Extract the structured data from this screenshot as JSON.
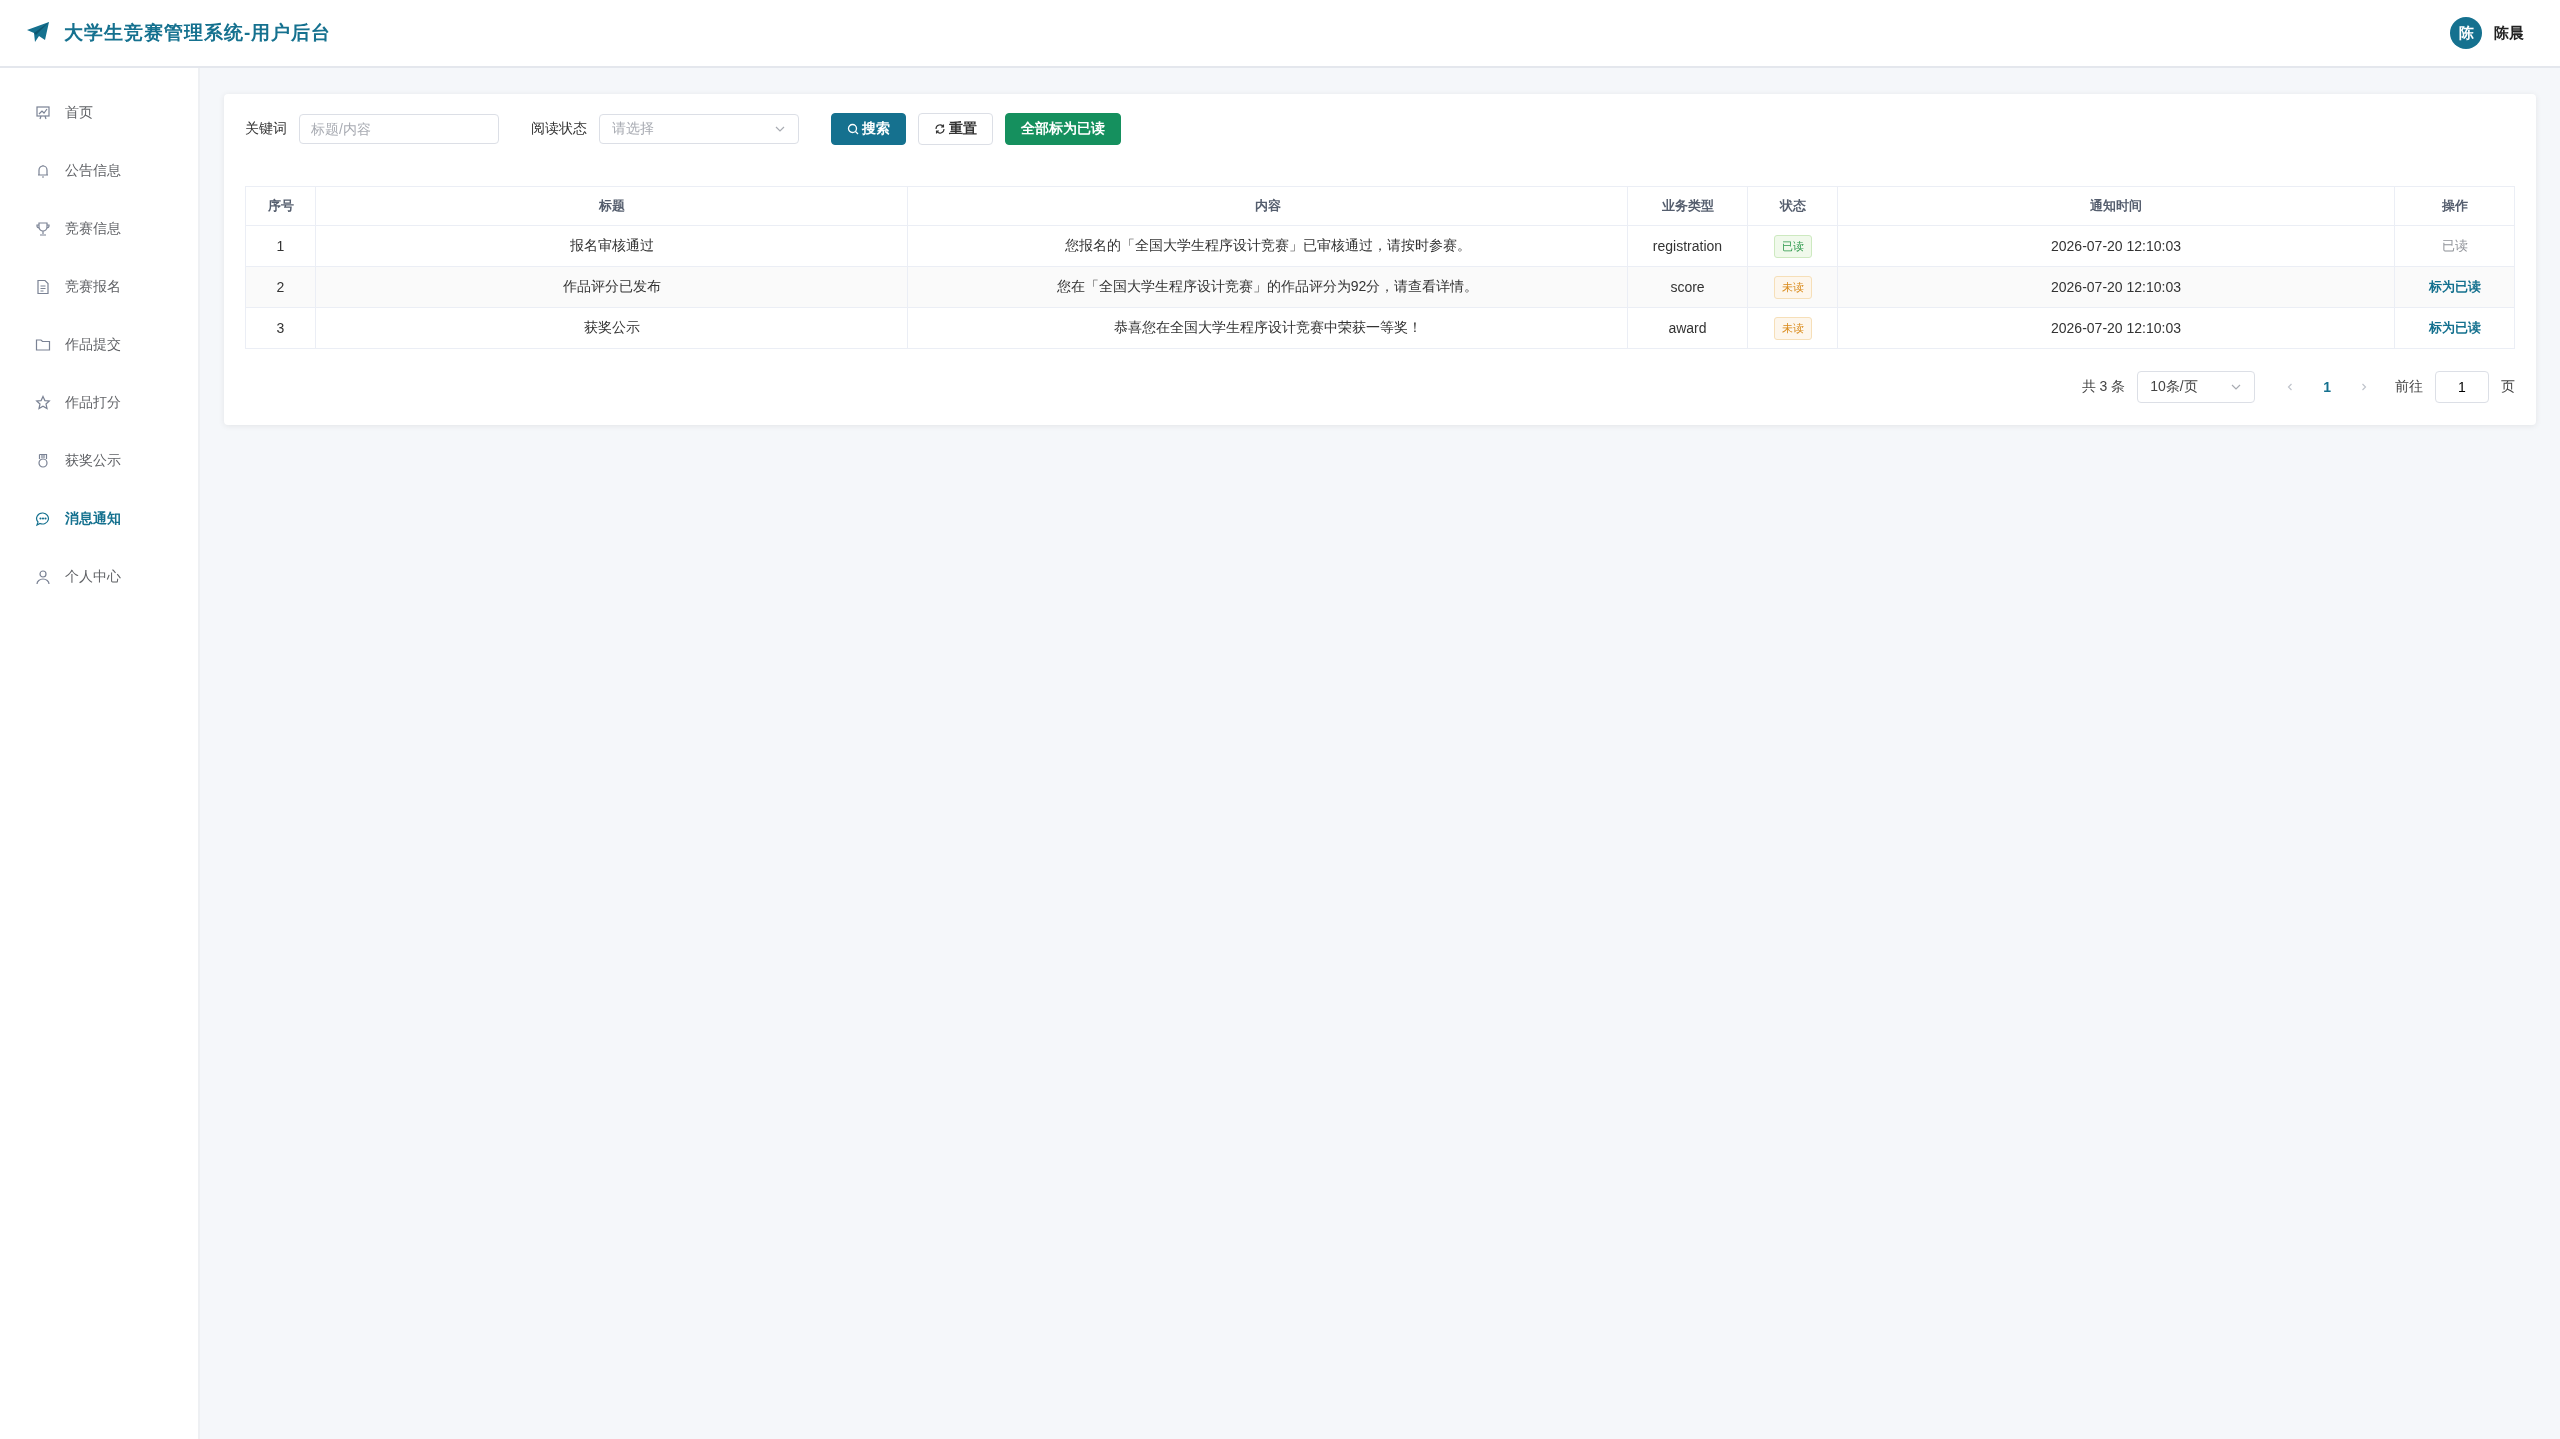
{
  "header": {
    "title": "大学生竞赛管理系统-用户后台",
    "user": {
      "avatar": "陈",
      "name": "陈晨"
    }
  },
  "sidebar": {
    "items": [
      {
        "label": "首页",
        "selected": false
      },
      {
        "label": "公告信息",
        "selected": false
      },
      {
        "label": "竞赛信息",
        "selected": false
      },
      {
        "label": "竞赛报名",
        "selected": false
      },
      {
        "label": "作品提交",
        "selected": false
      },
      {
        "label": "作品打分",
        "selected": false
      },
      {
        "label": "获奖公示",
        "selected": false
      },
      {
        "label": "消息通知",
        "selected": true
      },
      {
        "label": "个人中心",
        "selected": false
      }
    ]
  },
  "filters": {
    "keyword": {
      "label": "关键词",
      "placeholder": "标题/内容"
    },
    "read_status": {
      "label": "阅读状态",
      "placeholder": "请选择"
    },
    "buttons": [
      {
        "label": "搜索",
        "kind": "search"
      },
      {
        "label": "重置",
        "kind": "reset"
      },
      {
        "label": "全部标为已读",
        "kind": "success"
      }
    ]
  },
  "table": {
    "columns": [
      "序号",
      "标题",
      "内容",
      "业务类型",
      "状态",
      "通知时间",
      "操作"
    ],
    "rows": [
      {
        "index": "1",
        "title": "报名审核通过",
        "content": "您报名的「全国大学生程序设计竞赛」已审核通过，请按时参赛。",
        "type": "registration",
        "status": {
          "label": "已读",
          "read": true
        },
        "time": "2026-07-20 12:10:03",
        "action": {
          "label": "已读",
          "kind": "text"
        }
      },
      {
        "index": "2",
        "title": "作品评分已发布",
        "content": "您在「全国大学生程序设计竞赛」的作品评分为92分，请查看详情。",
        "type": "score",
        "status": {
          "label": "未读",
          "read": false
        },
        "time": "2026-07-20 12:10:03",
        "action": {
          "label": "标为已读",
          "kind": "link"
        }
      },
      {
        "index": "3",
        "title": "获奖公示",
        "content": "恭喜您在全国大学生程序设计竞赛中荣获一等奖！",
        "type": "award",
        "status": {
          "label": "未读",
          "read": false
        },
        "time": "2026-07-20 12:10:03",
        "action": {
          "label": "标为已读",
          "kind": "link"
        }
      }
    ]
  },
  "pagination": {
    "total": "共 3 条",
    "page_size": "10条/页",
    "pages": [
      {
        "label": "1",
        "selected": true
      }
    ],
    "goto_label": "前往",
    "goto_value": "1",
    "goto_suffix": "页"
  }
}
